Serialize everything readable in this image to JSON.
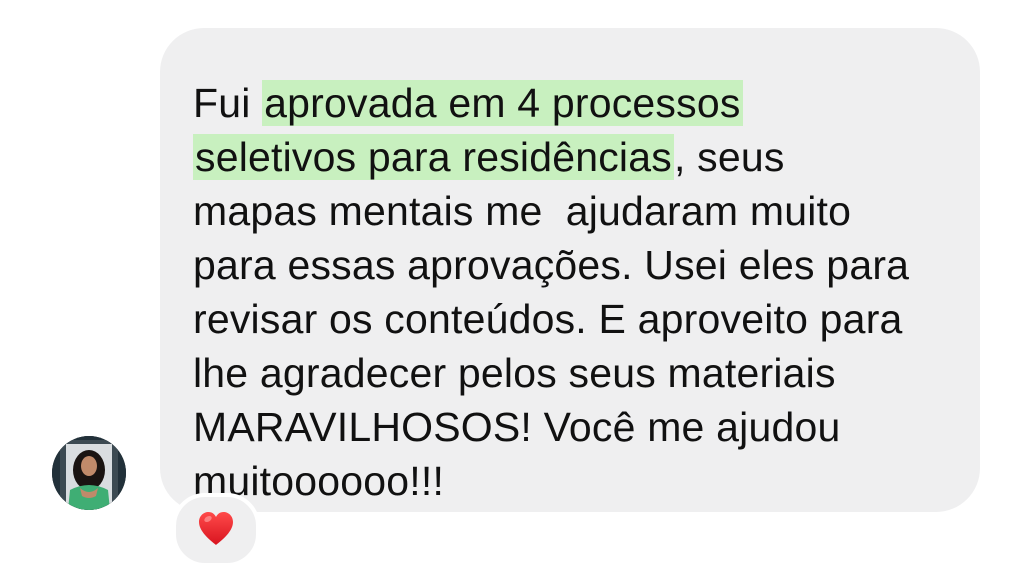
{
  "message": {
    "lines": [
      {
        "before": "Fui ",
        "highlight": "aprovada em 4 processos",
        "after": ""
      },
      {
        "before": "",
        "highlight": "seletivos para residências",
        "after": ", seus"
      },
      {
        "before": "mapas mentais me  ajudaram muito",
        "highlight": "",
        "after": ""
      },
      {
        "before": "para essas aprovações. Usei eles para",
        "highlight": "",
        "after": ""
      },
      {
        "before": "revisar os conteúdos. E aproveito para",
        "highlight": "",
        "after": ""
      },
      {
        "before": "lhe agradecer pelos seus materiais",
        "highlight": "",
        "after": ""
      },
      {
        "before": "MARAVILHOSOS! Você me ajudou",
        "highlight": "",
        "after": ""
      },
      {
        "before": "muitoooooo!!!",
        "highlight": "",
        "after": ""
      }
    ]
  },
  "reaction": {
    "icon": "heart-icon",
    "color": "#e8232e"
  },
  "colors": {
    "bubble": "#efeff0",
    "highlight": "#c8f0bf",
    "text": "#111111"
  }
}
